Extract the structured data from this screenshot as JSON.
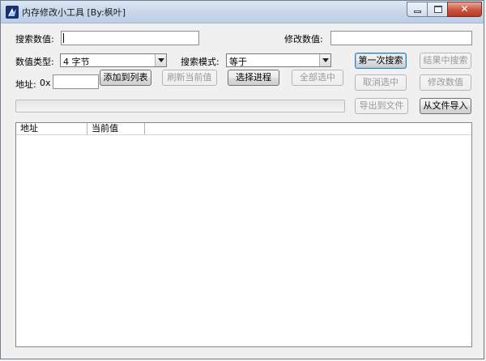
{
  "window": {
    "title": "内存修改小工具 [By:枫叶]",
    "icon": "app-icon",
    "controls": [
      "minimize-icon",
      "maximize-icon",
      "close-icon"
    ]
  },
  "search": {
    "label": "搜索数值:",
    "value": "",
    "modify_label": "修改数值:",
    "modify_value": ""
  },
  "options": {
    "type_label": "数值类型:",
    "type_value": "4 字节",
    "mode_label": "搜索模式:",
    "mode_value": "等于"
  },
  "address": {
    "label": "地址:",
    "prefix": "0x",
    "value": ""
  },
  "buttons": {
    "first_search": "第一次搜索",
    "search_in_results": "结果中搜索",
    "add_to_list": "添加到列表",
    "refresh_current": "刷新当前值",
    "select_process": "选择进程",
    "select_all": "全部选中",
    "cancel_selection": "取消选中",
    "modify_value": "修改数值",
    "export_to_file": "导出到文件",
    "import_from_file": "从文件导入"
  },
  "progress": {
    "percent": 0
  },
  "list": {
    "columns": [
      "地址",
      "当前值"
    ],
    "rows": []
  },
  "colors": {
    "accent": "#3c7fb1",
    "progress_fill": "#38c43a",
    "close_button": "#c8563f"
  }
}
